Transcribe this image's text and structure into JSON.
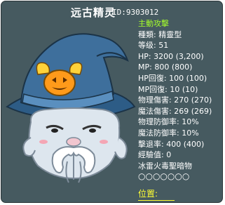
{
  "tooltip": {
    "name": "远古精灵",
    "id_text": "ID:9303012",
    "stats": [
      {
        "key": "aggressive",
        "text": "主動攻擊"
      },
      {
        "key": "species",
        "text": "種類: 精靈型"
      },
      {
        "key": "level",
        "text": "等级: 51"
      },
      {
        "key": "hp",
        "text": "HP: 3200 (3,200)"
      },
      {
        "key": "mp",
        "text": "MP: 800 (800)"
      },
      {
        "key": "hp_regen",
        "text": "HP回復: 100 (100)"
      },
      {
        "key": "mp_regen",
        "text": "MP回復: 10 (10)"
      },
      {
        "key": "phys_dmg",
        "text": "物理傷害: 270 (270)"
      },
      {
        "key": "magic_dmg",
        "text": "魔法傷害: 269 (269)"
      },
      {
        "key": "phys_def",
        "text": "物理防御率: 10%"
      },
      {
        "key": "magic_def",
        "text": "魔法防御率: 10%"
      },
      {
        "key": "knockback",
        "text": "擊退率: 400 (400)"
      },
      {
        "key": "exp",
        "text": "經驗值: 0"
      },
      {
        "key": "elements",
        "text": "冰雷火毒聖暗物"
      },
      {
        "key": "element_marks",
        "text": "○○○○○○○"
      }
    ],
    "location_label": "位置:"
  },
  "colors": {
    "panel_bg": "#465a60",
    "aggressive_text": "#a6ff2b",
    "location_text": "#ffff33",
    "hat": "#3e6f9c",
    "ghost_body": "#dde6ee"
  }
}
